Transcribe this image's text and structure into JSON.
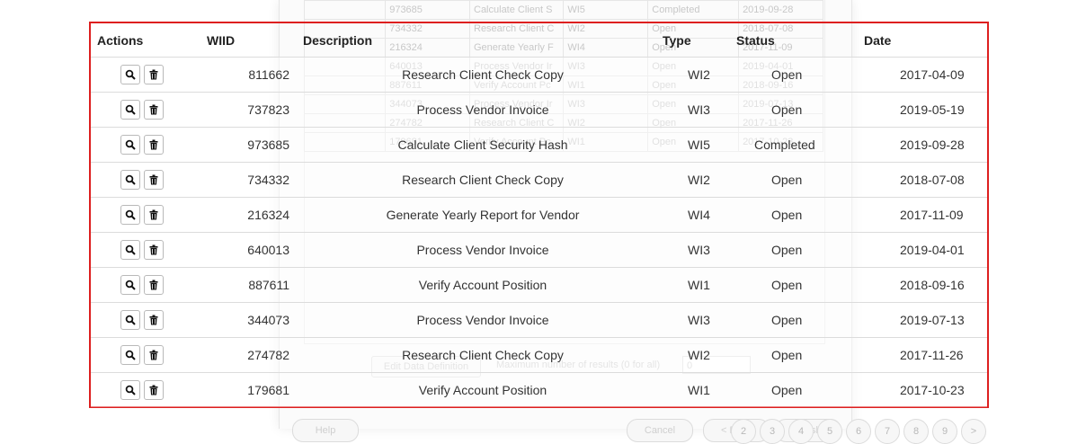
{
  "columns": {
    "actions": "Actions",
    "wiid": "WIID",
    "description": "Description",
    "type": "Type",
    "status": "Status",
    "date": "Date"
  },
  "rows": [
    {
      "wiid": "811662",
      "description": "Research Client Check Copy",
      "type": "WI2",
      "status": "Open",
      "date": "2017-04-09"
    },
    {
      "wiid": "737823",
      "description": "Process Vendor Invoice",
      "type": "WI3",
      "status": "Open",
      "date": "2019-05-19"
    },
    {
      "wiid": "973685",
      "description": "Calculate Client Security Hash",
      "type": "WI5",
      "status": "Completed",
      "date": "2019-09-28"
    },
    {
      "wiid": "734332",
      "description": "Research Client Check Copy",
      "type": "WI2",
      "status": "Open",
      "date": "2018-07-08"
    },
    {
      "wiid": "216324",
      "description": "Generate Yearly Report for Vendor",
      "type": "WI4",
      "status": "Open",
      "date": "2017-11-09"
    },
    {
      "wiid": "640013",
      "description": "Process Vendor Invoice",
      "type": "WI3",
      "status": "Open",
      "date": "2019-04-01"
    },
    {
      "wiid": "887611",
      "description": "Verify Account Position",
      "type": "WI1",
      "status": "Open",
      "date": "2018-09-16"
    },
    {
      "wiid": "344073",
      "description": "Process Vendor Invoice",
      "type": "WI3",
      "status": "Open",
      "date": "2019-07-13"
    },
    {
      "wiid": "274782",
      "description": "Research Client Check Copy",
      "type": "WI2",
      "status": "Open",
      "date": "2017-11-26"
    },
    {
      "wiid": "179681",
      "description": "Verify Account Position",
      "type": "WI1",
      "status": "Open",
      "date": "2017-10-23"
    }
  ],
  "background": {
    "rows": [
      {
        "wiid": "973685",
        "description": "Calculate Client S",
        "type": "WI5",
        "status": "Completed",
        "date": "2019-09-28"
      },
      {
        "wiid": "734332",
        "description": "Research Client C",
        "type": "WI2",
        "status": "Open",
        "date": "2018-07-08"
      },
      {
        "wiid": "216324",
        "description": "Generate Yearly F",
        "type": "WI4",
        "status": "Open",
        "date": "2017-11-09"
      },
      {
        "wiid": "640013",
        "description": "Process Vendor Ir",
        "type": "WI3",
        "status": "Open",
        "date": "2019-04-01"
      },
      {
        "wiid": "887611",
        "description": "Verify Account Pc",
        "type": "WI1",
        "status": "Open",
        "date": "2018-09-16"
      },
      {
        "wiid": "344073",
        "description": "Process Vendor Ir",
        "type": "WI3",
        "status": "Open",
        "date": "2019-07-13"
      },
      {
        "wiid": "274782",
        "description": "Research Client C",
        "type": "WI2",
        "status": "Open",
        "date": "2017-11-26"
      },
      {
        "wiid": "179681",
        "description": "Verify Account Pc",
        "type": "WI1",
        "status": "Open",
        "date": "2017-10-23"
      }
    ],
    "edit_data_definition": "Edit Data Definition",
    "max_results_label": "Maximum number of results (0 for all)",
    "max_results_value": "0",
    "help": "Help",
    "cancel": "Cancel",
    "back": "< Back",
    "finish": "Finish",
    "pages": [
      "2",
      "3",
      "4",
      "5",
      "6",
      "7",
      "8",
      "9",
      ">"
    ]
  },
  "icons": {
    "view": "magnifier-icon",
    "delete": "trash-icon"
  },
  "colors": {
    "highlight_border": "#dd1f1f"
  }
}
